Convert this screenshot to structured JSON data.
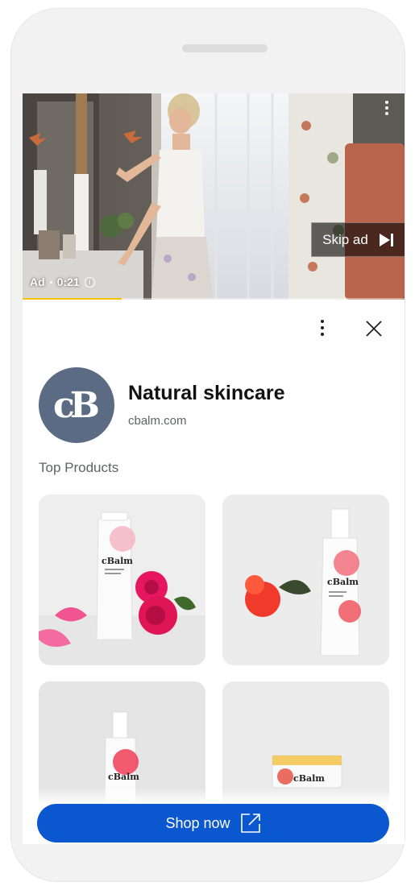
{
  "video": {
    "ad_label": "Ad",
    "time": "0:21",
    "skip_label": "Skip ad",
    "progress_fraction": 0.26,
    "progress_color": "#f5c400"
  },
  "brand": {
    "logo_text": "cB",
    "logo_color": "#5c6b84",
    "title": "Natural skincare",
    "url": "cbalm.com"
  },
  "section": {
    "title": "Top Products"
  },
  "products": [
    {
      "label": "cBalm"
    },
    {
      "label": "cBalm"
    },
    {
      "label": "cBalm"
    },
    {
      "label": "cBalm"
    }
  ],
  "cta": {
    "label": "Shop now",
    "color": "#0b57d0"
  },
  "icons": {
    "video_menu": "more-vert-icon",
    "skip": "skip-next-icon",
    "info": "info-icon",
    "panel_menu": "more-vert-icon",
    "close": "close-icon",
    "external": "open-external-icon"
  }
}
